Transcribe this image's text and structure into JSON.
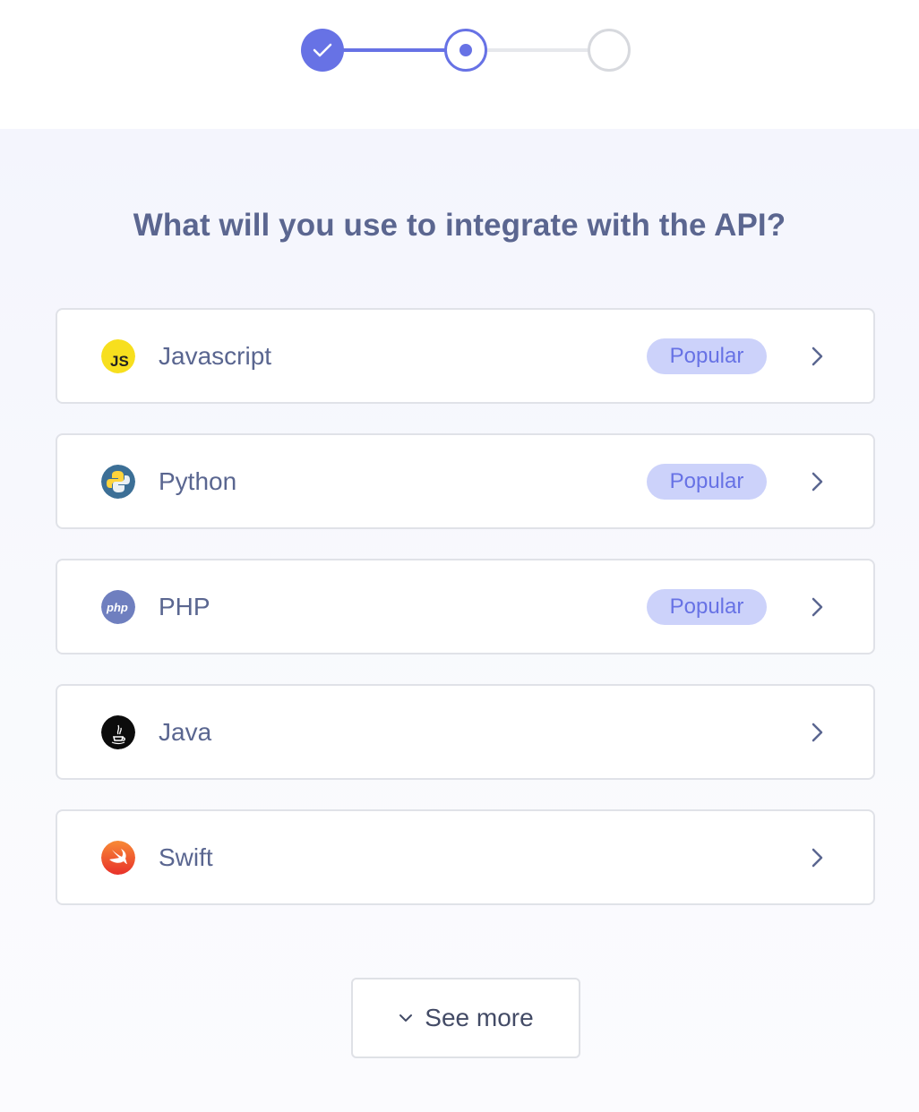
{
  "stepper": {
    "steps": [
      {
        "state": "completed"
      },
      {
        "state": "current"
      },
      {
        "state": "upcoming"
      }
    ],
    "accent": "#6772e5"
  },
  "heading": "What will you use to integrate with the API?",
  "options": [
    {
      "label": "Javascript",
      "icon": "javascript-logo-icon",
      "badge": "Popular"
    },
    {
      "label": "Python",
      "icon": "python-logo-icon",
      "badge": "Popular"
    },
    {
      "label": "PHP",
      "icon": "php-logo-icon",
      "badge": "Popular"
    },
    {
      "label": "Java",
      "icon": "java-logo-icon"
    },
    {
      "label": "Swift",
      "icon": "swift-logo-icon"
    }
  ],
  "see_more": {
    "label": "See more",
    "icon": "chevron-down-icon"
  },
  "colors": {
    "badge_bg": "#ccd2fa",
    "badge_text": "#6772e5",
    "heading_text": "#5b6690"
  }
}
